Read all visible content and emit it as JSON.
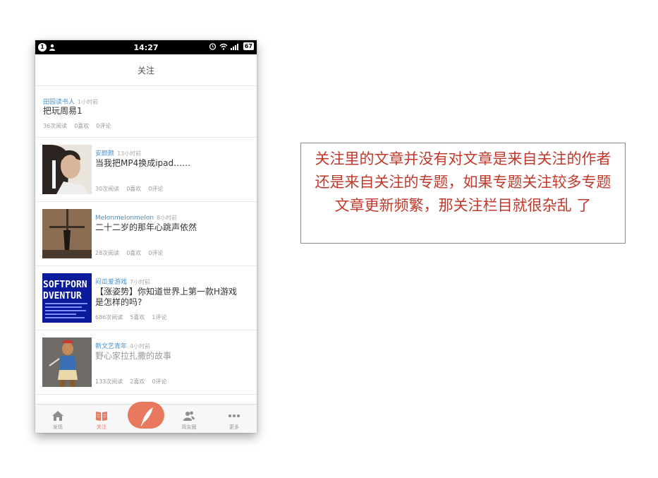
{
  "statusbar": {
    "notification_count": "1",
    "time": "14:27",
    "battery": "67",
    "icons": [
      "person-icon",
      "alarm-icon",
      "wifi-icon",
      "signal-icon",
      "battery-icon"
    ]
  },
  "nav": {
    "title": "关注"
  },
  "feed": [
    {
      "author": "田园读书人",
      "time": "1小时前",
      "title": "把玩周易1",
      "reads": "36次阅读",
      "likes": "0喜欢",
      "comments": "0评论"
    },
    {
      "author": "安颜颜",
      "time": "13小时前",
      "title": "当我把MP4换成ipad……",
      "reads": "30次阅读",
      "likes": "0喜欢",
      "comments": "0评论"
    },
    {
      "author": "Melonmelonmelon",
      "time": "8小时前",
      "title": "二十二岁的那年心跳声依然",
      "reads": "28次阅读",
      "likes": "0喜欢",
      "comments": "0评论"
    },
    {
      "author": "闷瓜爱游戏",
      "time": "7小时前",
      "title": "【涨姿势】你知道世界上第一款H游戏是怎样的吗?",
      "reads": "686次阅读",
      "likes": "5喜欢",
      "comments": "1评论",
      "thumb_text_1": "SOFTPORN",
      "thumb_text_2": "DVENTUR"
    },
    {
      "author": "新文艺青年",
      "time": "4小时前",
      "title": "野心家拉扎撒的故事",
      "reads": "133次阅读",
      "likes": "2喜欢",
      "comments": "0评论"
    }
  ],
  "tabbar": {
    "tabs": [
      {
        "label": "发现",
        "icon": "home-icon"
      },
      {
        "label": "关注",
        "icon": "book-icon"
      },
      {
        "label": "简友圈",
        "icon": "friends-icon"
      },
      {
        "label": "更多",
        "icon": "more-icon"
      }
    ],
    "write_icon": "feather-pen-icon",
    "active_color": "#e8795e"
  },
  "note": {
    "text": "关注里的文章并没有对文章是来自关注的作者还是来自关注的专题，如果专题关注较多专题文章更新频繁，那关注栏目就很杂乱 了",
    "color": "#c0392b"
  }
}
